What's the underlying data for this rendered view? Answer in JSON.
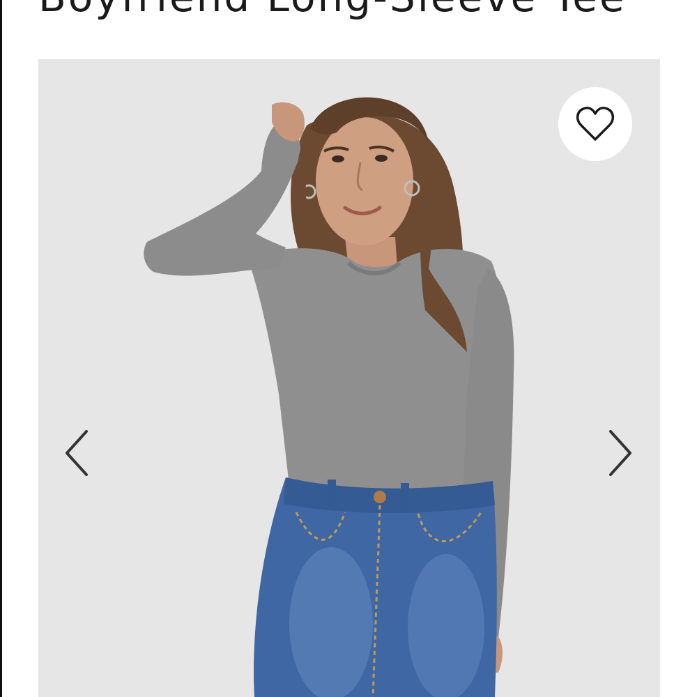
{
  "product": {
    "title": "Boyfriend Long-Sleeve Tee"
  },
  "gallery": {
    "favorite_icon": "heart-outline-icon",
    "prev_icon": "chevron-left-icon",
    "next_icon": "chevron-right-icon",
    "background_color": "#e6e6e6",
    "tee_color": "#8f8f8f",
    "jeans_color": "#3f67a3"
  }
}
